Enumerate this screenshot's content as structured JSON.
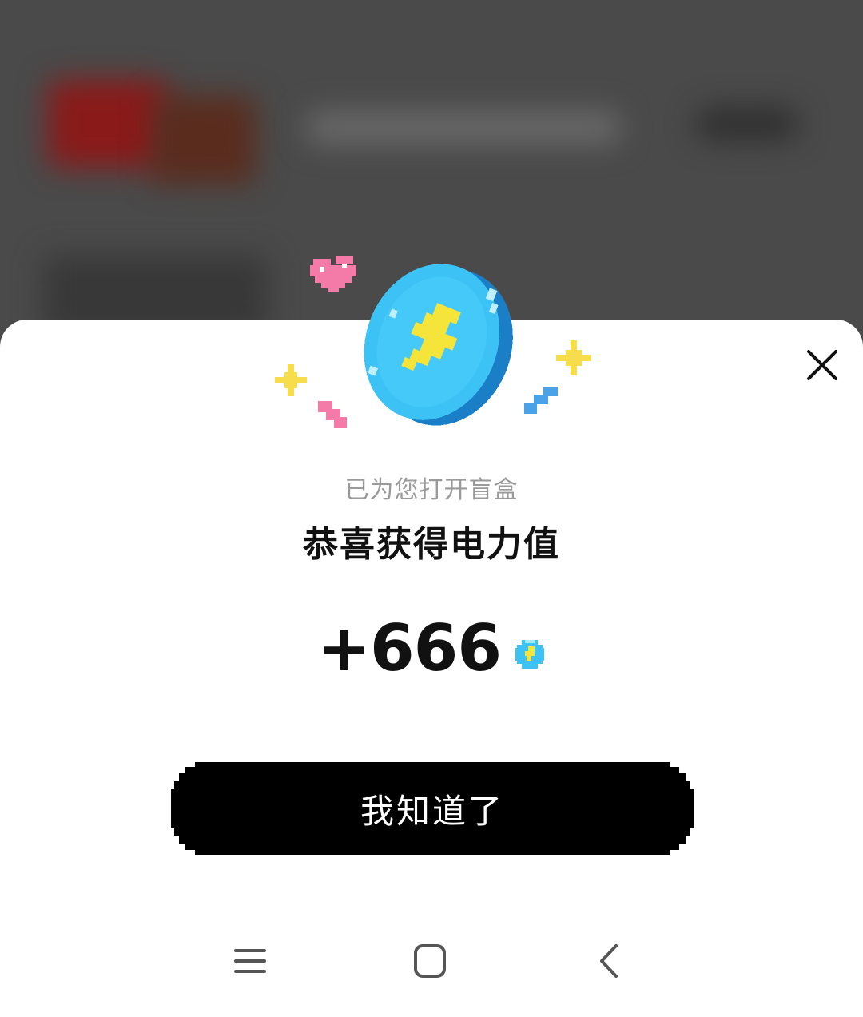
{
  "modal": {
    "subtitle": "已为您打开盲盒",
    "title": "恭喜获得电力值",
    "reward_amount": "+666",
    "reward_icon": "lightning-coin-icon",
    "confirm_label": "我知道了",
    "close_icon": "close-icon"
  },
  "nav_bar": {
    "menu_icon": "menu-icon",
    "home_icon": "home-icon",
    "back_icon": "back-icon"
  },
  "colors": {
    "coin_blue": "#3cc2f5",
    "coin_dark": "#1e8fd6",
    "bolt_yellow": "#f5e43a",
    "sparkle_yellow": "#f7dc4b",
    "heart_pink": "#f47aa8",
    "button_black": "#000000"
  }
}
